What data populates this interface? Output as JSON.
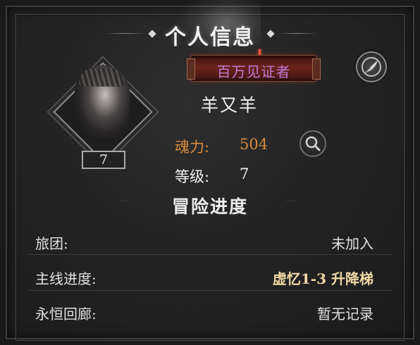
{
  "panel": {
    "title": "个人信息"
  },
  "profile": {
    "badge": "百万见证者",
    "name": "羊又羊",
    "avatar_level": "7",
    "soul_label": "魂力:",
    "soul_value": "504",
    "level_label": "等级:",
    "level_value": "7"
  },
  "adventure": {
    "title": "冒险进度",
    "rows": [
      {
        "label": "旅团:",
        "value": "未加入"
      },
      {
        "label": "主线进度:",
        "value": "虚忆1-3 升降梯"
      },
      {
        "label": "永恒回廊:",
        "value": "暂无记录"
      }
    ]
  },
  "colors": {
    "soul": "#d98a3e",
    "badge_text": "#c07bd4",
    "highlight_value": "#f0d8a6"
  }
}
